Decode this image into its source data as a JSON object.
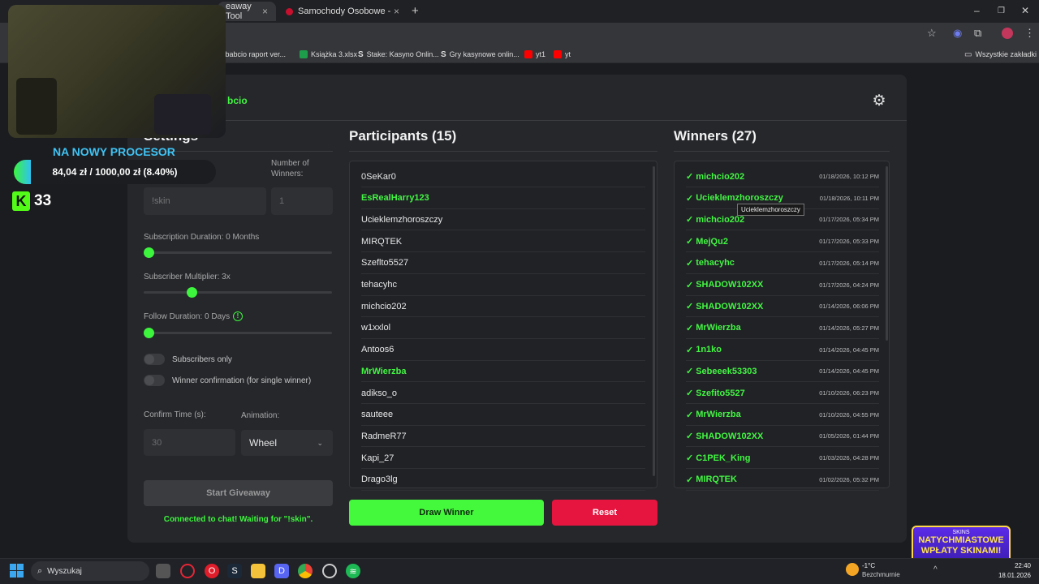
{
  "browser": {
    "tabs": [
      {
        "label": "eaway Tool",
        "active": true
      },
      {
        "label": "Samochody Osobowe - Otomo",
        "active": false
      }
    ],
    "new_tab": "+",
    "bookmarks": [
      {
        "label": "kebabcio raport ver...",
        "color": "#888888"
      },
      {
        "label": "Książka 3.xlsx",
        "color": "#1e9e4a"
      },
      {
        "label": "Stake: Kasyno Onlin...",
        "color": "#dddddd"
      },
      {
        "label": "Gry kasynowe onlin...",
        "color": "#dddddd"
      },
      {
        "label": "yt1",
        "color": "#ff0000"
      },
      {
        "label": "yt",
        "color": "#ff0000"
      }
    ],
    "all_bookmarks": "Wszystkie zakładki"
  },
  "overlay": {
    "goal_title": "NA NOWY PROCESOR",
    "goal_progress_text": "84,04 zł  /  1000,00 zł (8.40%)",
    "goal_fraction": 0.084,
    "viewer_count": "33",
    "kick_logo": "K"
  },
  "app": {
    "brand_partial": "bcio",
    "settings": {
      "title": "Settings",
      "num_winners_label": "Number of\nWinners:",
      "keyword_placeholder": "!skin",
      "num_winners_value": "1",
      "sub_duration_label": "Subscription Duration: 0 Months",
      "sub_duration_fraction": 0.0,
      "sub_multiplier_label": "Subscriber Multiplier: 3x",
      "sub_multiplier_fraction": 0.24,
      "follow_duration_label": "Follow Duration: 0 Days",
      "follow_duration_fraction": 0.0,
      "subscribers_only_label": "Subscribers only",
      "winner_confirm_label": "Winner confirmation (for single winner)",
      "confirm_time_label": "Confirm Time (s):",
      "confirm_time_value": "30",
      "animation_label": "Animation:",
      "animation_value": "Wheel",
      "start_button": "Start Giveaway",
      "status": "Connected to chat! Waiting for \"!skin\"."
    },
    "participants": {
      "title": "Participants (15)",
      "items": [
        {
          "name": "0SeKar0",
          "hl": false
        },
        {
          "name": "EsRealHarry123",
          "hl": true
        },
        {
          "name": "Ucieklemzhoroszczy",
          "hl": false
        },
        {
          "name": "MIRQTEK",
          "hl": false
        },
        {
          "name": "Szeflto5527",
          "hl": false
        },
        {
          "name": "tehacyhc",
          "hl": false
        },
        {
          "name": "michcio202",
          "hl": false
        },
        {
          "name": "w1xxlol",
          "hl": false
        },
        {
          "name": "Antoos6",
          "hl": false
        },
        {
          "name": "MrWierzba",
          "hl": true
        },
        {
          "name": "adikso_o",
          "hl": false
        },
        {
          "name": "sauteee",
          "hl": false
        },
        {
          "name": "RadmeR77",
          "hl": false
        },
        {
          "name": "Kapi_27",
          "hl": false
        },
        {
          "name": "Drago3lg",
          "hl": false
        }
      ],
      "draw_button": "Draw Winner",
      "reset_button": "Reset"
    },
    "winners": {
      "title": "Winners (27)",
      "tooltip": "Ucieklemzhoroszczy",
      "items": [
        {
          "name": "michcio202",
          "date": "01/18/2026, 10:12 PM"
        },
        {
          "name": "Ucieklemzhoroszczy",
          "date": "01/18/2026, 10:11 PM"
        },
        {
          "name": "michcio202",
          "date": "01/17/2026, 05:34 PM"
        },
        {
          "name": "MejQu2",
          "date": "01/17/2026, 05:33 PM"
        },
        {
          "name": "tehacyhc",
          "date": "01/17/2026, 05:14 PM"
        },
        {
          "name": "SHADOW102XX",
          "date": "01/17/2026, 04:24 PM"
        },
        {
          "name": "SHADOW102XX",
          "date": "01/14/2026, 06:06 PM"
        },
        {
          "name": "MrWierzba",
          "date": "01/14/2026, 05:27 PM"
        },
        {
          "name": "1n1ko",
          "date": "01/14/2026, 04:45 PM"
        },
        {
          "name": "Sebeeek53303",
          "date": "01/14/2026, 04:45 PM"
        },
        {
          "name": "Szefito5527",
          "date": "01/10/2026, 06:23 PM"
        },
        {
          "name": "MrWierzba",
          "date": "01/10/2026, 04:55 PM"
        },
        {
          "name": "SHADOW102XX",
          "date": "01/05/2026, 01:44 PM"
        },
        {
          "name": "C1PEK_King",
          "date": "01/03/2026, 04:28 PM"
        },
        {
          "name": "MIRQTEK",
          "date": "01/02/2026, 05:32 PM"
        }
      ]
    }
  },
  "promo": {
    "line1": "NATYCHMIASTOWE",
    "line2": "WPŁATY SKINAMI!",
    "brand": "SKINS"
  },
  "taskbar": {
    "search_placeholder": "Wyszukaj",
    "weather_temp": "-1°C",
    "weather_desc": "Bezchmurnie",
    "time": "22:40",
    "date": "18.01.2026"
  }
}
